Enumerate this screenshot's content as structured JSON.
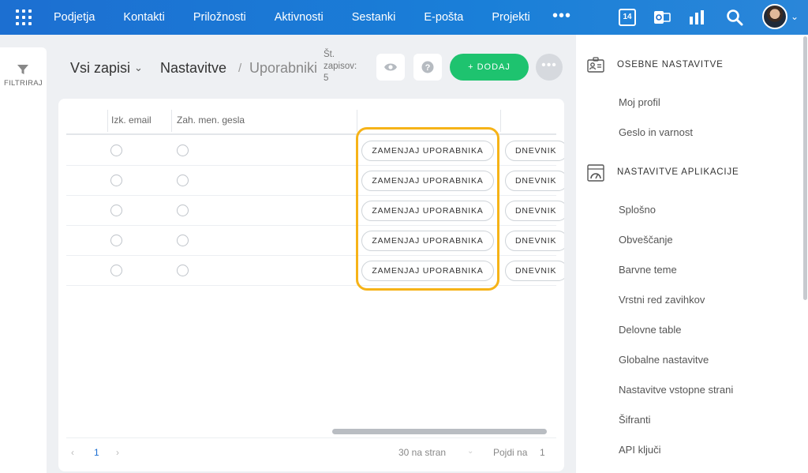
{
  "topnav": {
    "items": [
      "Podjetja",
      "Kontakti",
      "Priložnosti",
      "Aktivnosti",
      "Sestanki",
      "E-pošta",
      "Projekti"
    ],
    "more": "•••",
    "calendar_day": "14"
  },
  "leftbar": {
    "filter_label": "FILTRIRAJ"
  },
  "header": {
    "view_title": "Vsi zapisi",
    "breadcrumb_root": "Nastavitve",
    "breadcrumb_sep": "/",
    "breadcrumb_current": "Uporabniki",
    "count_label_1": "Št.",
    "count_label_2": "zapisov:",
    "count_value": "5",
    "add_label": "+ DODAJ",
    "more_label": "•••"
  },
  "table": {
    "columns": [
      "Izk. email",
      "Zah. men. gesla"
    ],
    "row_count": 5,
    "swap_label": "ZAMENJAJ UPORABNIKA",
    "log_label": "DNEVNIK"
  },
  "pager": {
    "prev": "‹",
    "page": "1",
    "next": "›",
    "per_page": "30 na stran",
    "goto_label": "Pojdi na",
    "goto_value": "1"
  },
  "rightpanel": {
    "section1_title": "OSEBNE NASTAVITVE",
    "section1_items": [
      "Moj profil",
      "Geslo in varnost"
    ],
    "section2_title": "NASTAVITVE APLIKACIJE",
    "section2_items": [
      "Splošno",
      "Obveščanje",
      "Barvne teme",
      "Vrstni red zavihkov",
      "Delovne table",
      "Globalne nastavitve",
      "Nastavitve vstopne strani",
      "Šifranti",
      "API ključi"
    ]
  },
  "colors": {
    "nav_blue": "#1c6fd1",
    "add_green": "#1ec36f",
    "highlight_orange": "#f6b318"
  }
}
